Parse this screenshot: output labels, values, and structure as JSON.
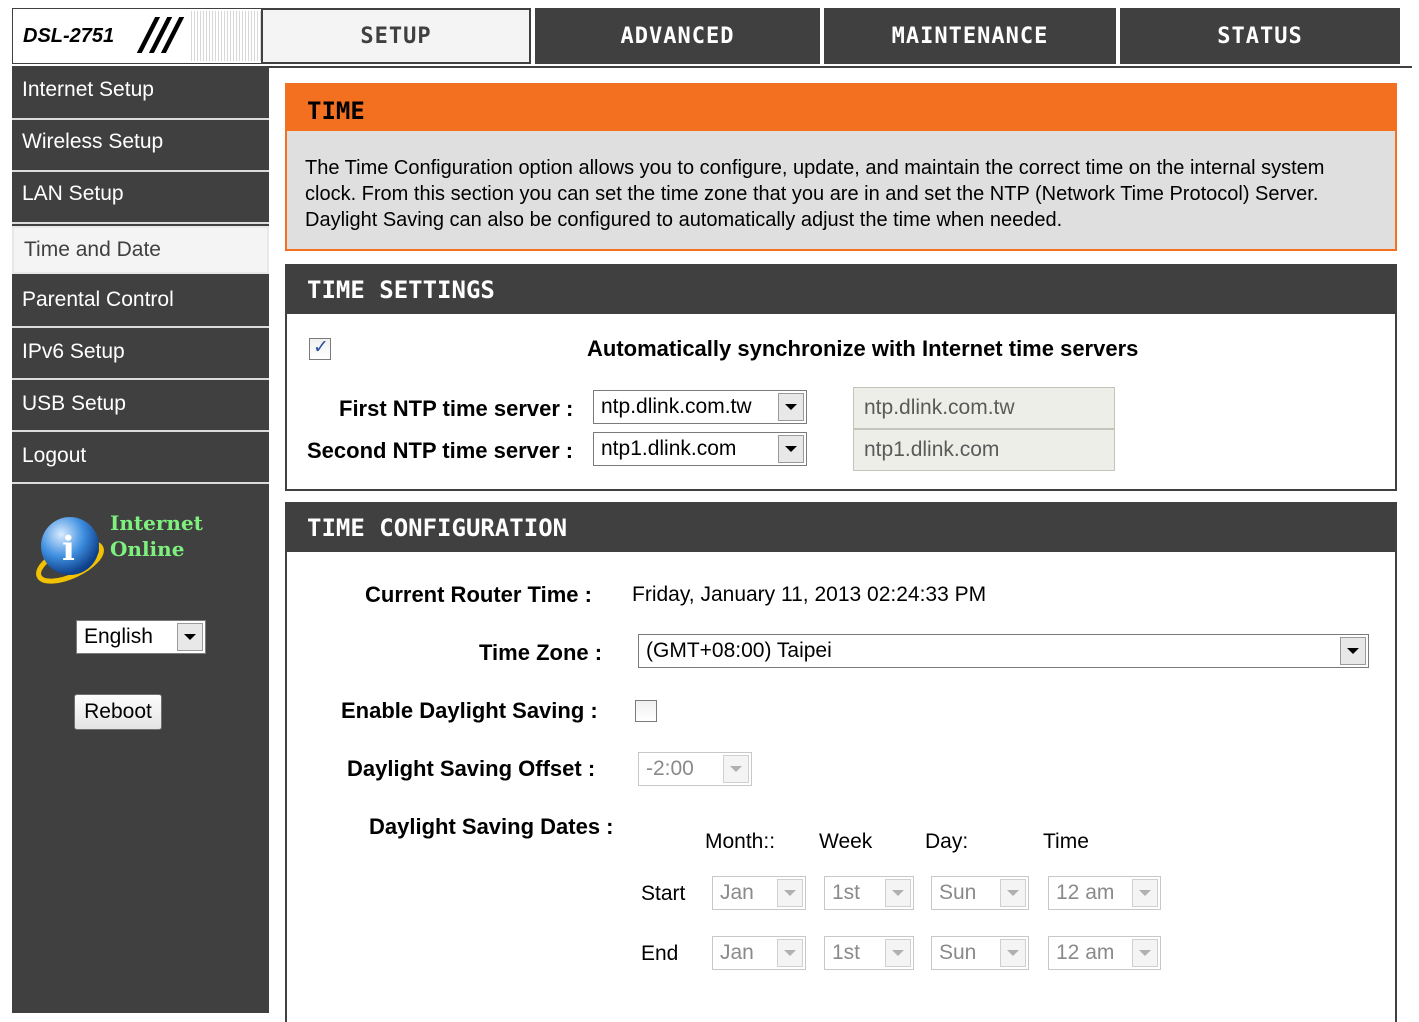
{
  "header": {
    "brand": "DSL-2751",
    "tabs": [
      {
        "label": "SETUP",
        "active": true
      },
      {
        "label": "ADVANCED",
        "active": false
      },
      {
        "label": "MAINTENANCE",
        "active": false
      },
      {
        "label": "STATUS",
        "active": false
      }
    ]
  },
  "sidebar": {
    "items": [
      {
        "label": "Internet Setup",
        "active": false
      },
      {
        "label": "Wireless Setup",
        "active": false
      },
      {
        "label": "LAN Setup",
        "active": false
      },
      {
        "label": "Time and Date",
        "active": true
      },
      {
        "label": "Parental Control",
        "active": false
      },
      {
        "label": "IPv6 Setup",
        "active": false
      },
      {
        "label": "USB Setup",
        "active": false
      },
      {
        "label": "Logout",
        "active": false
      }
    ],
    "status_line1": "Internet",
    "status_line2": "Online",
    "status_icon": "info-globe-icon",
    "language": "English",
    "reboot_label": "Reboot"
  },
  "time_panel": {
    "title": "TIME",
    "description": "The Time Configuration option allows you to configure, update, and maintain the correct time on the internal system clock. From this section you can set the time zone that you are in and set the NTP (Network Time Protocol) Server. Daylight Saving can also be configured to automatically adjust the time when needed."
  },
  "time_settings": {
    "title": "TIME SETTINGS",
    "auto_sync_label": "Automatically synchronize with Internet time servers",
    "auto_sync_checked": true,
    "first_ntp_label": "First NTP time server :",
    "first_ntp_value": "ntp.dlink.com.tw",
    "first_ntp_display": "ntp.dlink.com.tw",
    "second_ntp_label": "Second NTP time server :",
    "second_ntp_value": "ntp1.dlink.com",
    "second_ntp_display": "ntp1.dlink.com"
  },
  "time_config": {
    "title": "TIME CONFIGURATION",
    "current_time_label": "Current Router Time :",
    "current_time_value": "Friday, January 11, 2013 02:24:33 PM",
    "time_zone_label": "Time Zone :",
    "time_zone_value": "(GMT+08:00) Taipei",
    "dst_enable_label": "Enable Daylight Saving :",
    "dst_enable_checked": false,
    "dst_offset_label": "Daylight Saving Offset :",
    "dst_offset_value": "-2:00",
    "dst_dates_label": "Daylight Saving Dates :",
    "col_month": "Month::",
    "col_week": "Week",
    "col_day": "Day:",
    "col_time": "Time",
    "start_label": "Start",
    "start": {
      "month": "Jan",
      "week": "1st",
      "day": "Sun",
      "time": "12 am"
    },
    "end_label": "End",
    "end": {
      "month": "Jan",
      "week": "1st",
      "day": "Sun",
      "time": "12 am"
    }
  },
  "colors": {
    "accent_orange": "#f37021",
    "dark_gray": "#404040",
    "online_green": "#7ef07e"
  }
}
